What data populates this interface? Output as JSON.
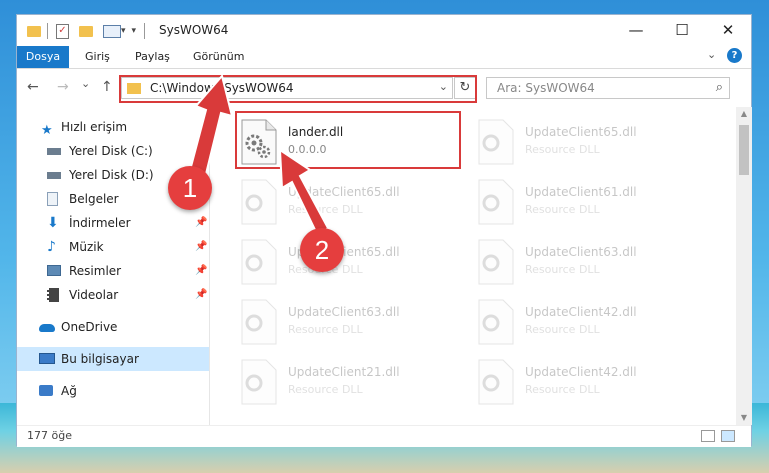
{
  "window": {
    "title": "SysWOW64",
    "minimize": "—",
    "maximize": "☐",
    "close": "✕"
  },
  "ribbon": {
    "tabs": [
      "Dosya",
      "Giriş",
      "Paylaş",
      "Görünüm"
    ],
    "expand_icon": "chevron-down-icon",
    "help": "?"
  },
  "nav": {
    "back": "←",
    "forward": "→",
    "recent": "⌄",
    "up": "↑",
    "address": "C:\\Windows\\SysWOW64",
    "address_dropdown": "⌄",
    "refresh": "↻",
    "search_placeholder": "Ara: SysWOW64",
    "search_icon": "⌕"
  },
  "sidebar": {
    "items": [
      {
        "label": "Hızlı erişim",
        "icon": "star-icon",
        "color": "#1979ca"
      },
      {
        "label": "Yerel Disk (C:)",
        "icon": "drive-icon",
        "color": "#6b7d8f"
      },
      {
        "label": "Yerel Disk (D:)",
        "icon": "drive-icon",
        "color": "#6b7d8f"
      },
      {
        "label": "Belgeler",
        "icon": "documents-icon",
        "color": "#8aa0b8"
      },
      {
        "label": "İndirmeler",
        "icon": "download-icon",
        "color": "#1979ca"
      },
      {
        "label": "Müzik",
        "icon": "music-icon",
        "color": "#1979ca"
      },
      {
        "label": "Resimler",
        "icon": "pictures-icon",
        "color": "#5d8ab5"
      },
      {
        "label": "Videolar",
        "icon": "videos-icon",
        "color": "#444444"
      },
      {
        "label": "OneDrive",
        "icon": "cloud-icon",
        "color": "#1979ca"
      },
      {
        "label": "Bu bilgisayar",
        "icon": "computer-icon",
        "color": "#3a7bc8"
      },
      {
        "label": "Ağ",
        "icon": "network-icon",
        "color": "#3a7bc8"
      }
    ],
    "pin": "📌"
  },
  "files": [
    {
      "name": "lander.dll",
      "sub": "0.0.0.0"
    },
    {
      "name": "UpdateClient65.dll",
      "sub": "Resource DLL"
    },
    {
      "name": "UpdateClient65.dll",
      "sub": "Resource DLL"
    },
    {
      "name": "UpdateClient61.dll",
      "sub": "Resource DLL"
    },
    {
      "name": "UpdateClient65.dll",
      "sub": "Resource DLL"
    },
    {
      "name": "UpdateClient63.dll",
      "sub": "Resource DLL"
    },
    {
      "name": "UpdateClient63.dll",
      "sub": "Resource DLL"
    },
    {
      "name": "UpdateClient42.dll",
      "sub": "Resource DLL"
    },
    {
      "name": "UpdateClient21.dll",
      "sub": "Resource DLL"
    },
    {
      "name": "UpdateClient42.dll",
      "sub": "Resource DLL"
    }
  ],
  "status": {
    "count": "177 öğe"
  },
  "annotations": {
    "marker1": "1",
    "marker2": "2",
    "color": "#d93a3a"
  }
}
